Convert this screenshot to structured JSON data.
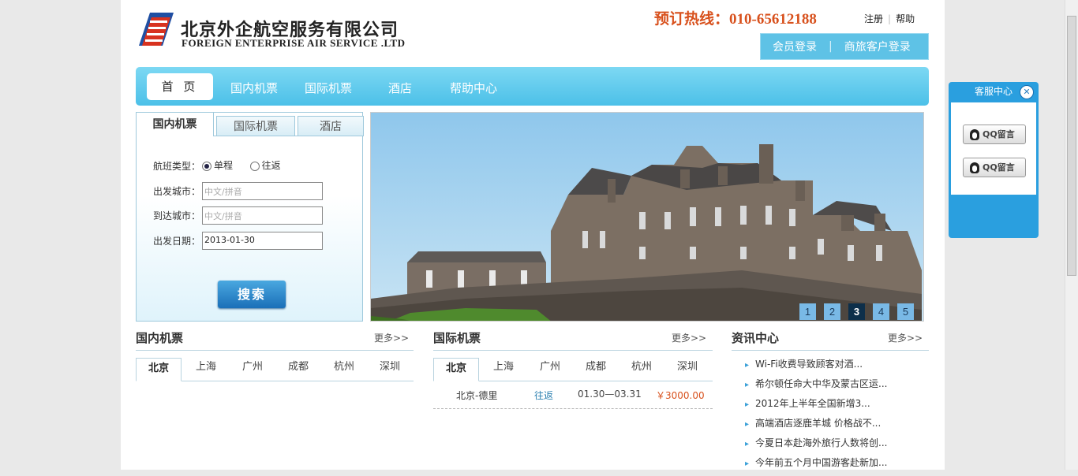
{
  "header": {
    "company_cn": "北京外企航空服务有限公司",
    "company_en": "FOREIGN ENTERPRISE AIR SERVICE .LTD",
    "hotline": "预订热线：010-65612188",
    "register": "注册",
    "help": "帮助",
    "member_login": "会员登录",
    "business_login": "商旅客户登录"
  },
  "nav": {
    "home": "首 页",
    "items": [
      "国内机票",
      "国际机票",
      "酒店",
      "帮助中心"
    ]
  },
  "search": {
    "tabs": [
      "国内机票",
      "国际机票",
      "酒店"
    ],
    "flight_type_label": "航班类型：",
    "one_way": "单程",
    "round_trip": "往返",
    "depart_city_label": "出发城市：",
    "depart_city_placeholder": "中文/拼音",
    "arrive_city_label": "到达城市：",
    "arrive_city_placeholder": "中文/拼音",
    "depart_date_label": "出发日期：",
    "depart_date_value": "2013-01-30",
    "search_button": "搜索"
  },
  "banner": {
    "pages": [
      "1",
      "2",
      "3",
      "4",
      "5"
    ],
    "current_page": "3"
  },
  "domestic": {
    "title": "国内机票",
    "more": "更多>>",
    "cities": [
      "北京",
      "上海",
      "广州",
      "成都",
      "杭州",
      "深圳"
    ]
  },
  "international": {
    "title": "国际机票",
    "more": "更多>>",
    "cities": [
      "北京",
      "上海",
      "广州",
      "成都",
      "杭州",
      "深圳"
    ],
    "deals": [
      {
        "route": "北京-德里",
        "trip": "往返",
        "dates": "01.30—03.31",
        "price": "￥3000.00"
      }
    ]
  },
  "news": {
    "title": "资讯中心",
    "more": "更多>>",
    "items": [
      "Wi-Fi收费导致顾客对酒...",
      "希尔顿任命大中华及蒙古区运...",
      "2012年上半年全国新增3...",
      "高端酒店逐鹿羊城 价格战不...",
      "今夏日本赴海外旅行人数将创...",
      "今年前五个月中国游客赴新加..."
    ]
  },
  "service": {
    "title": "客服中心",
    "close": "✕",
    "qq_buttons": [
      "QQ留言",
      "QQ留言"
    ]
  },
  "colors": {
    "accent": "#4cc0e8",
    "hotline": "#d8511d",
    "price": "#d8511d",
    "service_bg": "#2a9fdf"
  }
}
